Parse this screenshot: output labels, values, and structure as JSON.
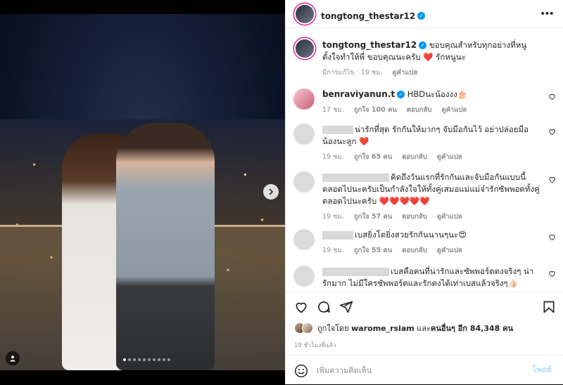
{
  "post": {
    "username": "tongtong_thestar12",
    "verified": true,
    "image_indicator": {
      "total": 10,
      "active_index": 0
    }
  },
  "caption": {
    "username": "tongtong_thestar12",
    "text": "ขอบคุณสำหรับทุกอย่างที่หนูตั้งใจทำให้พี่ ขอบคุณนะครับ ❤️ รักหนูนะ",
    "edited_label": "มีการแก้ไข",
    "time": "19 ชม.",
    "translate": "ดูคำแปล"
  },
  "comments": [
    {
      "username": "benraviyanun.t",
      "verified": true,
      "text": "HBDนะน้องงง🎂",
      "time": "17 ชม.",
      "likes": "ถูกใจ 100 คน",
      "reply": "ตอบกลับ",
      "translate": "ดูคำแปล"
    },
    {
      "username": "",
      "text": "น่ารักที่สุด รักกันให้มากๆ จับมือกันไว้ อย่าปล่อยมือน้องนะลูก ❤️",
      "time": "19 ชม.",
      "likes": "ถูกใจ 65 คน",
      "reply": "ตอบกลับ",
      "translate": "ดูคำแปล"
    },
    {
      "username": "",
      "text": "คิดถึงวันแรกที่รักกันและจับมือกันแบบนี้ตลอดไปนะครับเป็นกำลังใจให้ทั้งคู่เสมอแม่แม่จ๋ารักซัพพอตทั้งคู่ตลอดไปนะครับ ❤️❤️❤️❤️❤️",
      "time": "19 ชม.",
      "likes": "ถูกใจ 57 คน",
      "reply": "ตอบกลับ",
      "translate": "ดูคำแปล"
    },
    {
      "username": "",
      "text": "เบสยิ่งโตยิ่งสวยรักกันนานๆนะ😍",
      "time": "19 ชม.",
      "likes": "ถูกใจ 55 คน",
      "reply": "ตอบกลับ",
      "translate": "ดูคำแปล"
    },
    {
      "username": "",
      "text": "เบสคือคนที่น่ารักและซัพพอร์ตตงจริงๆ น่ารักมาก ไม่มีใครซัพพอร์ตและรักตงได้เท่าเบสแล้วจริงๆ👍🏻"
    }
  ],
  "likes": {
    "prefix": "ถูกใจโดย",
    "user": "warome_rsiam",
    "connector": "และ",
    "others": "คนอื่นๆ อีก 84,348 คน"
  },
  "time_ago": "19 ชั่วโมงที่แล้ว",
  "add_comment": {
    "placeholder": "เพิ่มความคิดเห็น",
    "post_label": "โพสต์"
  },
  "colors": {
    "verified": "#0095f6",
    "heart_red": "#ed4956",
    "meta_grey": "#8e8e8e",
    "post_disabled": "#b2dffc",
    "story_ring": "#d6249f"
  },
  "icons": [
    "more-icon",
    "verified-icon",
    "heart-icon",
    "comment-icon",
    "share-icon",
    "bookmark-icon",
    "emoji-icon",
    "chevron-right-icon",
    "tag-user-icon"
  ]
}
